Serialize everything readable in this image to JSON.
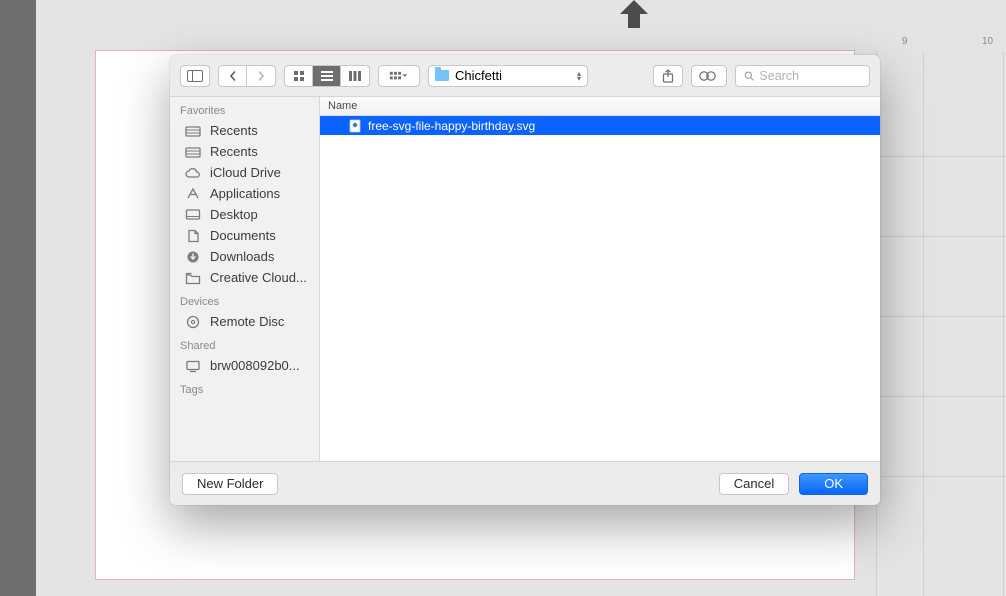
{
  "ruler": {
    "m9": "9",
    "m10": "10"
  },
  "toolbar": {
    "path_folder": "Chicfetti",
    "search_placeholder": "Search"
  },
  "sidebar": {
    "sections": {
      "favorites": "Favorites",
      "devices": "Devices",
      "shared": "Shared",
      "tags": "Tags"
    },
    "favorites": [
      {
        "label": "Recents"
      },
      {
        "label": "Recents"
      },
      {
        "label": "iCloud Drive"
      },
      {
        "label": "Applications"
      },
      {
        "label": "Desktop"
      },
      {
        "label": "Documents"
      },
      {
        "label": "Downloads"
      },
      {
        "label": "Creative Cloud..."
      }
    ],
    "devices": [
      {
        "label": "Remote Disc"
      }
    ],
    "shared": [
      {
        "label": "brw008092b0..."
      }
    ]
  },
  "filearea": {
    "column_header": "Name",
    "rows": [
      {
        "name": "free-svg-file-happy-birthday.svg",
        "selected": true
      }
    ]
  },
  "footer": {
    "new_folder": "New Folder",
    "cancel": "Cancel",
    "ok": "OK"
  }
}
